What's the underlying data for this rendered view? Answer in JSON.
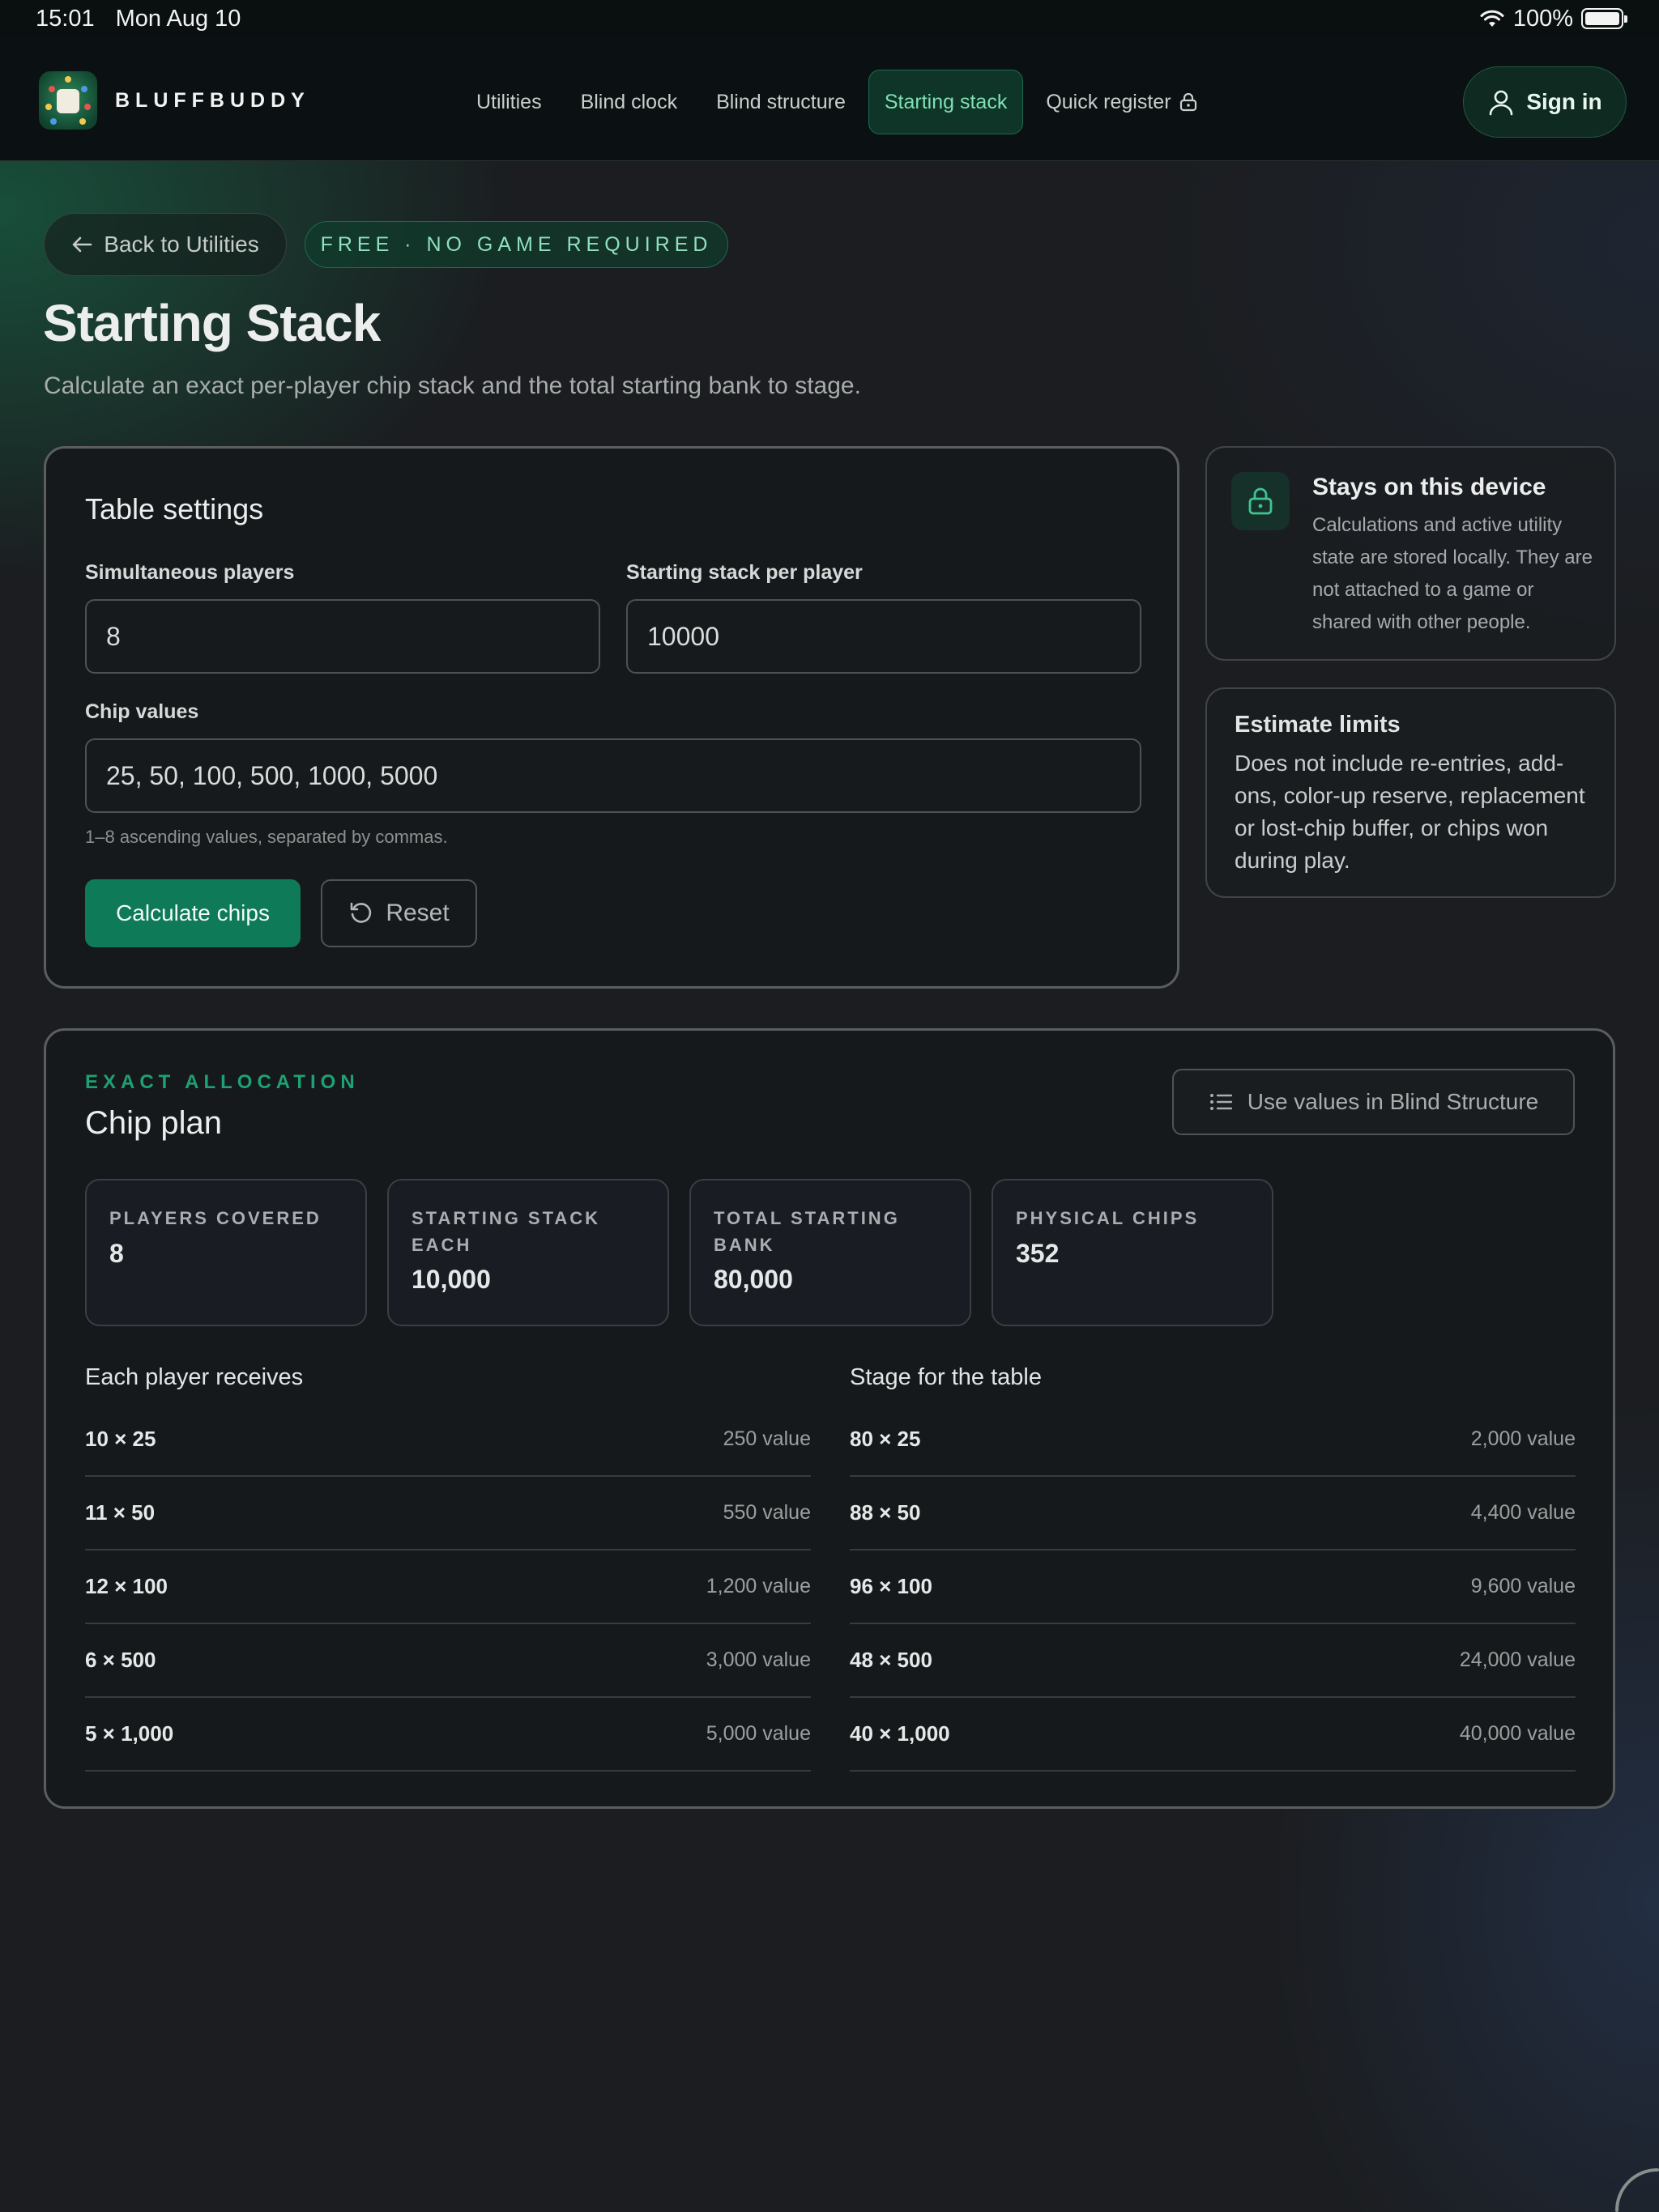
{
  "status_bar": {
    "time": "15:01",
    "date": "Mon Aug 10",
    "battery": "100%"
  },
  "nav": {
    "brand": "BLUFFBUDDY",
    "links": [
      {
        "label": "Utilities"
      },
      {
        "label": "Blind clock"
      },
      {
        "label": "Blind structure"
      },
      {
        "label": "Starting stack",
        "active": true
      },
      {
        "label": "Quick register",
        "locked": true
      }
    ],
    "sign_in": "Sign in"
  },
  "header": {
    "back_label": "Back to Utilities",
    "badge": "FREE · NO GAME REQUIRED",
    "title": "Starting Stack",
    "subtitle": "Calculate an exact per-player chip stack and the total starting bank to stage."
  },
  "settings": {
    "title": "Table settings",
    "players_label": "Simultaneous players",
    "players_value": "8",
    "stack_label": "Starting stack per player",
    "stack_value": "10000",
    "chips_label": "Chip values",
    "chips_value": "25, 50, 100, 500, 1000, 5000",
    "chips_hint": "1–8 ascending values, separated by commas.",
    "calculate_label": "Calculate chips",
    "reset_label": "Reset"
  },
  "device_card": {
    "title": "Stays on this device",
    "text": "Calculations and active utility state are stored locally. They are not attached to a game or shared with other people."
  },
  "limits_card": {
    "title": "Estimate limits",
    "text": "Does not include re-entries, add-ons, color-up reserve, replacement or lost-chip buffer, or chips won during play."
  },
  "plan": {
    "kicker": "EXACT ALLOCATION",
    "title": "Chip plan",
    "use_values_label": "Use values in Blind Structure",
    "stats": [
      {
        "label": "PLAYERS COVERED",
        "value": "8"
      },
      {
        "label": "STARTING STACK EACH",
        "value": "10,000"
      },
      {
        "label": "TOTAL STARTING BANK",
        "value": "80,000"
      },
      {
        "label": "PHYSICAL CHIPS",
        "value": "352"
      }
    ],
    "per_player_heading": "Each player receives",
    "per_player": [
      {
        "qty": "10 × 25",
        "value": "250 value"
      },
      {
        "qty": "11 × 50",
        "value": "550 value"
      },
      {
        "qty": "12 × 100",
        "value": "1,200 value"
      },
      {
        "qty": "6 × 500",
        "value": "3,000 value"
      },
      {
        "qty": "5 × 1,000",
        "value": "5,000 value"
      }
    ],
    "table_heading": "Stage for the table",
    "table": [
      {
        "qty": "80 × 25",
        "value": "2,000 value"
      },
      {
        "qty": "88 × 50",
        "value": "4,400 value"
      },
      {
        "qty": "96 × 100",
        "value": "9,600 value"
      },
      {
        "qty": "48 × 500",
        "value": "24,000 value"
      },
      {
        "qty": "40 × 1,000",
        "value": "40,000 value"
      }
    ]
  },
  "colors": {
    "accent": "#0e7a57",
    "accent_text": "#7fe0b4",
    "background": "#1b1d20"
  }
}
